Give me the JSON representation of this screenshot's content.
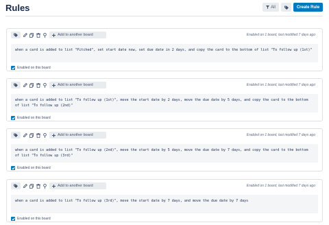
{
  "header": {
    "title": "Rules",
    "filter_label": "All",
    "create_label": "Create Rule"
  },
  "rules": [
    {
      "add_board_label": "Add to another board",
      "meta": "Enabled on 1 board, last modified 7 days ago",
      "description": "when a card is added to list \"Pitched\", set start date now, set due date in 2 days, and copy the card to the bottom of list \"To follow up (1st)\"",
      "enabled_label": "Enabled on this board",
      "enabled": true
    },
    {
      "add_board_label": "Add to another board",
      "meta": "Enabled on 1 board, last modified 7 days ago",
      "description": "when a card is added to list \"To follow up (1st)\", move the start date by 2 days, move the due date by 5 days, and copy the card to the bottom of list \"To follow up (2nd)\"",
      "enabled_label": "Enabled on this board",
      "enabled": true
    },
    {
      "add_board_label": "Add to another board",
      "meta": "Enabled on 1 board, last modified 7 days ago",
      "description": "when a card is added to list \"To follow up (2nd)\", move the start date by 5 days, move the due date by 7 days, and copy the card to the bottom of list \"To follow up (3rd)\"",
      "enabled_label": "Enabled on this board",
      "enabled": true
    },
    {
      "add_board_label": "Add to another board",
      "meta": "Enabled on 1 board, last modified 7 days ago",
      "description": "when a card is added to list \"To follow up (3rd)\", move the start date by 7 days, and move the due date by 7 days",
      "enabled_label": "Enabled on this board",
      "enabled": true
    }
  ],
  "colors": {
    "accent": "#0079bf",
    "button_bg": "#e9ecef",
    "desc_bg": "#f4f5f7"
  },
  "icons": [
    "tag-icon",
    "filter-icon",
    "edit-icon",
    "copy-icon",
    "delete-icon",
    "pin-icon",
    "plus-icon",
    "check-icon"
  ]
}
